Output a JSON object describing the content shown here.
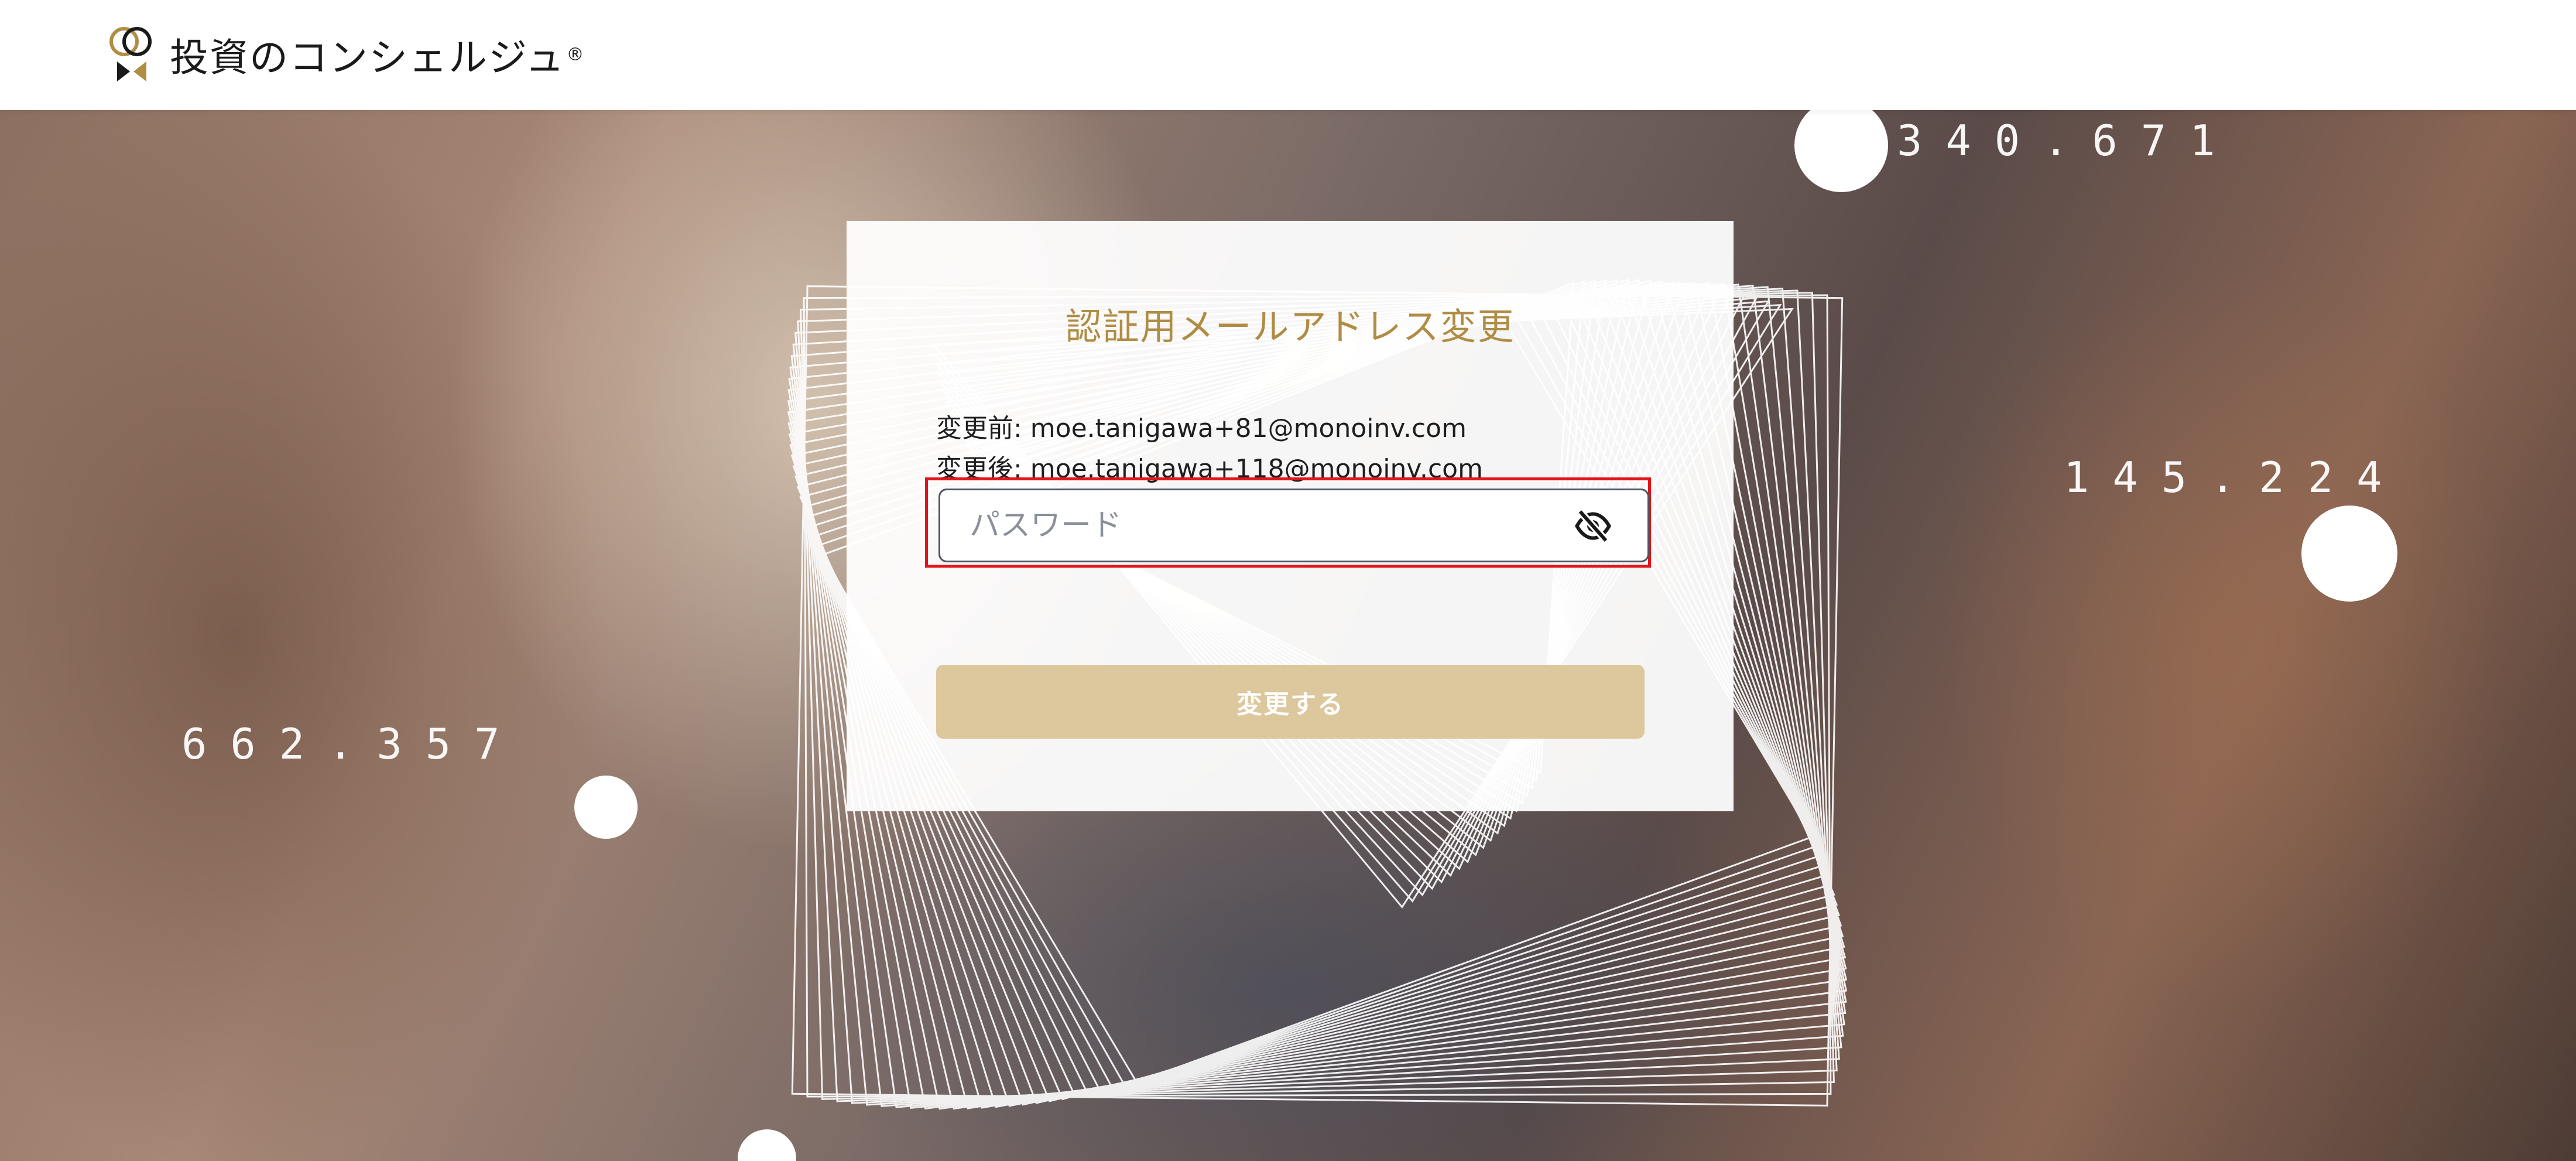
{
  "header": {
    "logo_text": "投資のコンシェルジュ",
    "logo_reg": "®"
  },
  "hero": {
    "numbers": {
      "top_right": "340.671",
      "right": "145.224",
      "left": "662.357"
    }
  },
  "form": {
    "title": "認証用メールアドレス変更",
    "before_label": "変更前: moe.tanigawa+81@monoinv.com",
    "after_label": "変更後: moe.tanigawa+118@monoinv.com",
    "password_placeholder": "パスワード",
    "submit_label": "変更する"
  },
  "colors": {
    "accent": "#b08d45",
    "button": "#ddc79d",
    "highlight": "#e3151a"
  },
  "icons": {
    "logo": "concierge-logo-icon",
    "password_toggle": "eye-slash-icon"
  }
}
